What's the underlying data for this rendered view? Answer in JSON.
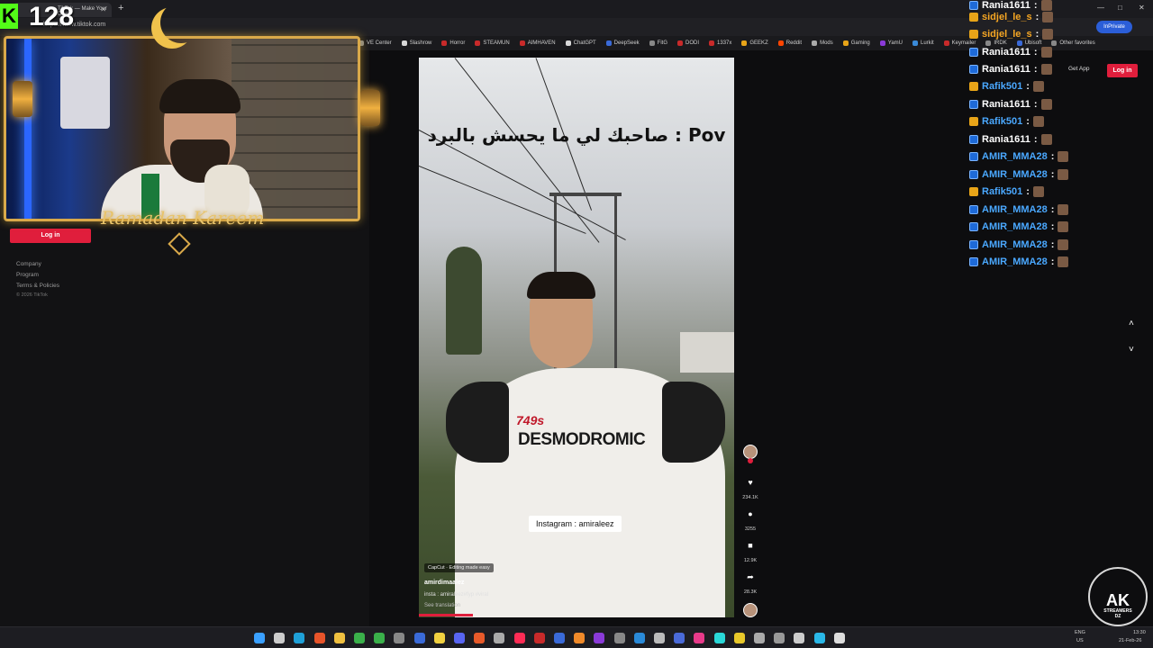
{
  "overlay": {
    "viewer_count": "128",
    "stream_banner": "Ramadan Kareem"
  },
  "browser": {
    "tab_title": "TikTok — Make Your Day",
    "new_tab": "+",
    "url": "https://www.tiktok.com",
    "inprivate": "InPrivate",
    "window_controls": [
      "—",
      "□",
      "✕"
    ],
    "bookmarks": [
      {
        "label": "VE Center",
        "color": "#888888"
      },
      {
        "label": "Slashrow",
        "color": "#d8d8d8"
      },
      {
        "label": "Horror",
        "color": "#c82a2a"
      },
      {
        "label": "STEAMUN",
        "color": "#c82a2a"
      },
      {
        "label": "AIMHAVEN",
        "color": "#c82a2a"
      },
      {
        "label": "ChatGPT",
        "color": "#d8d8d8"
      },
      {
        "label": "DeepSeek",
        "color": "#3a6ad8"
      },
      {
        "label": "FitG",
        "color": "#888888"
      },
      {
        "label": "DODI",
        "color": "#c82a2a"
      },
      {
        "label": "1337x",
        "color": "#c82a2a"
      },
      {
        "label": "GEEKZ",
        "color": "#e8a418"
      },
      {
        "label": "Reddit",
        "color": "#ff4500"
      },
      {
        "label": "Mods",
        "color": "#aaaaaa"
      },
      {
        "label": "Gaming",
        "color": "#e8a418"
      },
      {
        "label": "YamU",
        "color": "#8a3ad8"
      },
      {
        "label": "Lurkit",
        "color": "#3a8ad8"
      },
      {
        "label": "Keymailer",
        "color": "#c82a2a"
      },
      {
        "label": "IRDK",
        "color": "#888888"
      },
      {
        "label": "Ubisoft",
        "color": "#3a6ad8"
      },
      {
        "label": "Other favorites",
        "color": "#888888"
      }
    ]
  },
  "sidebar": {
    "login_label": "Log in",
    "footer_links": [
      "Company",
      "Program",
      "Terms & Policies"
    ],
    "copyright": "© 2026 TikTok"
  },
  "header": {
    "get_app_label": "Get App",
    "login_label": "Log in"
  },
  "video": {
    "top_text": "صاحبك لي ما يحسش بالبرد : Pov",
    "shirt_number": "749s",
    "shirt_text": "DESMODROMIC",
    "insta_tag": "Instagram : amiraleez",
    "capcut_label": "CapCut · Editing made easy",
    "username": "amirdimaalez",
    "caption": "insta : amiraleez#fyp #viral",
    "see_translation": "See translation"
  },
  "actions": {
    "likes": "234.1K",
    "comments": "3255",
    "saves": "12.9K",
    "shares": "28.3K"
  },
  "nav": {
    "up": "˄",
    "down": "˅"
  },
  "chat": [
    {
      "user": "Rania1611",
      "badge": "blue",
      "color": "#ffffff"
    },
    {
      "user": "sidjel_le_s",
      "badge": "gold",
      "color": "#f5a623"
    },
    {
      "user": "sidjel_le_s",
      "badge": "gold",
      "color": "#f5a623"
    },
    {
      "user": "Rania1611",
      "badge": "blue",
      "color": "#ffffff"
    },
    {
      "user": "Rania1611",
      "badge": "blue",
      "color": "#ffffff"
    },
    {
      "user": "Rafik501",
      "badge": "gold",
      "color": "#4aa8ff"
    },
    {
      "user": "Rania1611",
      "badge": "blue",
      "color": "#ffffff"
    },
    {
      "user": "Rafik501",
      "badge": "gold",
      "color": "#4aa8ff"
    },
    {
      "user": "Rania1611",
      "badge": "blue",
      "color": "#ffffff"
    },
    {
      "user": "AMIR_MMA28",
      "badge": "blue",
      "color": "#4aa8ff"
    },
    {
      "user": "AMIR_MMA28",
      "badge": "blue",
      "color": "#4aa8ff"
    },
    {
      "user": "Rafik501",
      "badge": "gold",
      "color": "#4aa8ff"
    },
    {
      "user": "AMIR_MMA28",
      "badge": "blue",
      "color": "#4aa8ff"
    },
    {
      "user": "AMIR_MMA28",
      "badge": "blue",
      "color": "#4aa8ff"
    },
    {
      "user": "AMIR_MMA28",
      "badge": "blue",
      "color": "#4aa8ff"
    },
    {
      "user": "AMIR_MMA28",
      "badge": "blue",
      "color": "#4aa8ff"
    }
  ],
  "logo": {
    "title": "AK",
    "subtitle": "STREAMERS",
    "tag": "DZ"
  },
  "taskbar": {
    "lang_top": "ENG",
    "lang_bottom": "US",
    "time": "13:30",
    "date": "21-Feb-26",
    "icons": [
      {
        "name": "windows-start-icon",
        "color": "#3aa0ff"
      },
      {
        "name": "search-icon",
        "color": "#cccccc"
      },
      {
        "name": "edge-icon",
        "color": "#1fa0d8"
      },
      {
        "name": "brave-icon",
        "color": "#e8542a"
      },
      {
        "name": "folder-icon",
        "color": "#f0c040"
      },
      {
        "name": "app-icon-green",
        "color": "#3ab04a"
      },
      {
        "name": "xbox-icon",
        "color": "#3ab04a"
      },
      {
        "name": "app-icon-grey",
        "color": "#888888"
      },
      {
        "name": "steam-icon",
        "color": "#3a6ad8"
      },
      {
        "name": "app-icon-yellow",
        "color": "#f0d040"
      },
      {
        "name": "discord-icon",
        "color": "#5865f2"
      },
      {
        "name": "app-icon-orange",
        "color": "#e85a2a"
      },
      {
        "name": "app-icon-grey",
        "color": "#aaaaaa"
      },
      {
        "name": "tiktok-icon",
        "color": "#fe2c55"
      },
      {
        "name": "app-icon-red",
        "color": "#c82a2a"
      },
      {
        "name": "app-icon-blue",
        "color": "#3a6ad8"
      },
      {
        "name": "app-icon-orange",
        "color": "#f08a2a"
      },
      {
        "name": "app-icon-purple",
        "color": "#8a3ad8"
      },
      {
        "name": "app-icon-grey",
        "color": "#888888"
      },
      {
        "name": "vscode-icon",
        "color": "#2a8ad8"
      },
      {
        "name": "app-icon-grey",
        "color": "#bbbbbb"
      },
      {
        "name": "app-icon-blue",
        "color": "#4a6ad8"
      },
      {
        "name": "app-icon-pink",
        "color": "#e83a8a"
      },
      {
        "name": "app-icon-cyan",
        "color": "#2ad8d8"
      },
      {
        "name": "app-icon-yellow",
        "color": "#e8c82a"
      },
      {
        "name": "app-icon-grey",
        "color": "#aaaaaa"
      },
      {
        "name": "app-icon-grey",
        "color": "#999999"
      },
      {
        "name": "app-icon-grey",
        "color": "#cccccc"
      },
      {
        "name": "app-icon-cyan",
        "color": "#2ab8e8"
      },
      {
        "name": "app-icon-grey",
        "color": "#dddddd"
      }
    ]
  }
}
